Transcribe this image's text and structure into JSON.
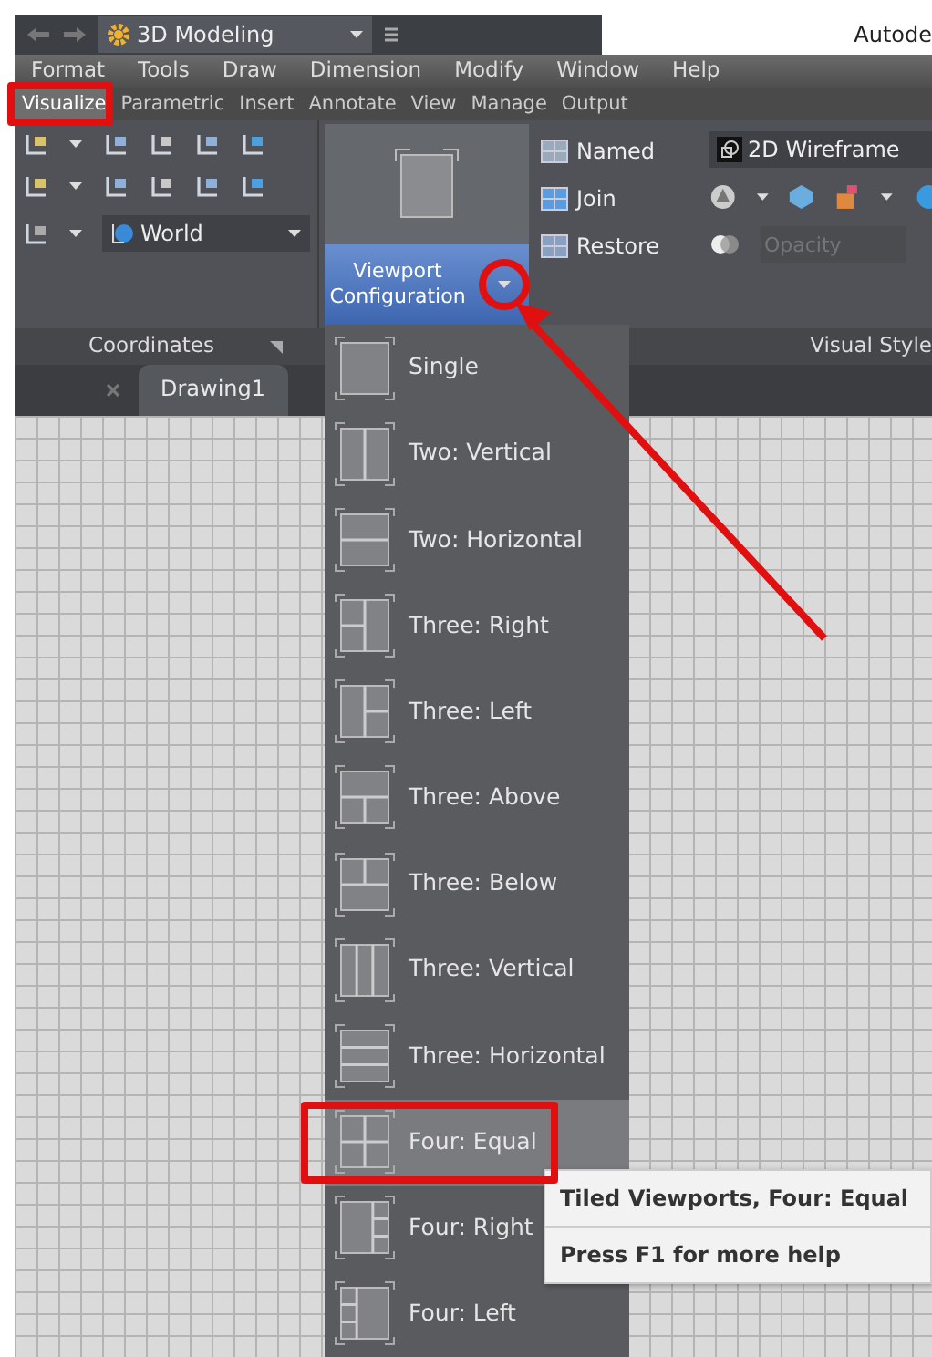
{
  "top_toolbar": {
    "workspace": "3D Modeling"
  },
  "title": "Autode",
  "menu_bar": [
    "Format",
    "Tools",
    "Draw",
    "Dimension",
    "Modify",
    "Window",
    "Help"
  ],
  "ribbon_tabs": [
    {
      "label": "Visualize",
      "selected": true,
      "callout": true
    },
    {
      "label": "Parametric",
      "selected": false,
      "callout": false
    },
    {
      "label": "Insert",
      "selected": false,
      "callout": false
    },
    {
      "label": "Annotate",
      "selected": false,
      "callout": false
    },
    {
      "label": "View",
      "selected": false,
      "callout": false
    },
    {
      "label": "Manage",
      "selected": false,
      "callout": false
    },
    {
      "label": "Output",
      "selected": false,
      "callout": false
    }
  ],
  "coordinates_panel": {
    "ucs": "World",
    "title": "Coordinates"
  },
  "viewports_panel": {
    "button": "Viewport Configuration",
    "callout": true,
    "tools": [
      "Named",
      "Join",
      "Restore"
    ]
  },
  "visual_styles_panel": {
    "style": "2D Wireframe",
    "opacity_placeholder": "Opacity",
    "title": "Visual Style"
  },
  "file_tabs": [
    {
      "label": "Drawing1"
    }
  ],
  "viewport_menu": {
    "items": [
      {
        "label": "Single",
        "selected": false,
        "callout": false
      },
      {
        "label": "Two: Vertical",
        "selected": false,
        "callout": false
      },
      {
        "label": "Two: Horizontal",
        "selected": false,
        "callout": false
      },
      {
        "label": "Three: Right",
        "selected": false,
        "callout": false
      },
      {
        "label": "Three: Left",
        "selected": false,
        "callout": false
      },
      {
        "label": "Three: Above",
        "selected": false,
        "callout": false
      },
      {
        "label": "Three: Below",
        "selected": false,
        "callout": false
      },
      {
        "label": "Three: Vertical",
        "selected": false,
        "callout": false
      },
      {
        "label": "Three: Horizontal",
        "selected": false,
        "callout": false
      },
      {
        "label": "Four: Equal",
        "selected": true,
        "callout": true
      },
      {
        "label": "Four: Right",
        "selected": false,
        "callout": false
      },
      {
        "label": "Four: Left",
        "selected": false,
        "callout": false
      }
    ]
  },
  "tooltip": {
    "title": "Tiled Viewports, Four:  Equal",
    "hint": "Press F1 for more help"
  }
}
